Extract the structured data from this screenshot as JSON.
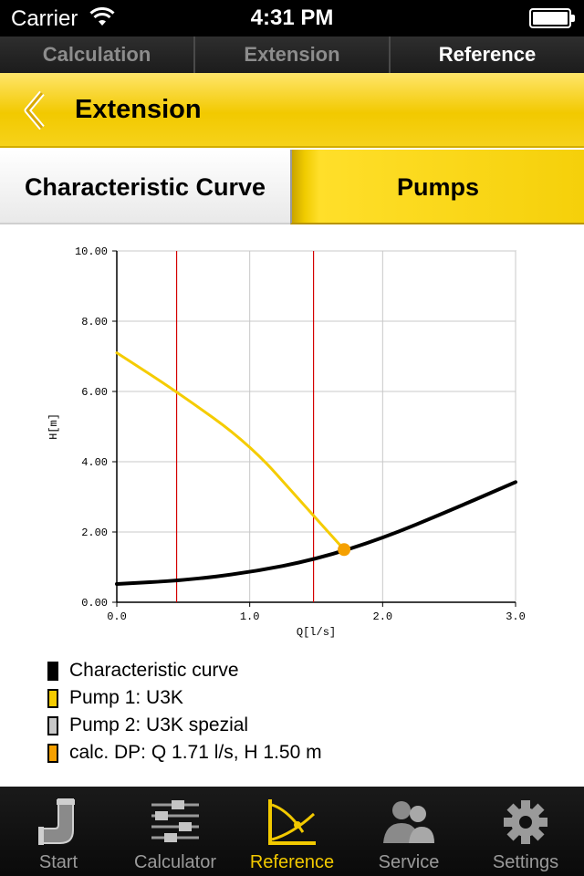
{
  "status_bar": {
    "carrier": "Carrier",
    "time": "4:31 PM"
  },
  "top_tabs": [
    {
      "label": "Calculation",
      "active": false
    },
    {
      "label": "Extension",
      "active": false
    },
    {
      "label": "Reference",
      "active": true
    }
  ],
  "header": {
    "title": "Extension",
    "back_icon": "chevron-left-icon"
  },
  "segments": {
    "left": "Characteristic Curve",
    "right": "Pumps",
    "selected": "Characteristic Curve"
  },
  "chart_data": {
    "type": "line",
    "xlabel": "Q[l/s]",
    "ylabel": "H[m]",
    "xlim": [
      0,
      3
    ],
    "ylim": [
      0,
      10
    ],
    "x_ticks": [
      "0.0",
      "1.0",
      "2.0",
      "3.0"
    ],
    "y_ticks": [
      "0.00",
      "2.00",
      "4.00",
      "6.00",
      "8.00",
      "10.00"
    ],
    "grid": true,
    "vertical_markers": [
      0.45,
      1.48
    ],
    "series": [
      {
        "name": "Characteristic curve",
        "color": "#000000",
        "x": [
          0.0,
          0.5,
          1.0,
          1.5,
          2.0,
          2.5,
          3.0
        ],
        "y": [
          0.52,
          0.62,
          0.85,
          1.22,
          1.82,
          2.6,
          3.42
        ]
      },
      {
        "name": "Pump 1: U3K",
        "color": "#f5cc00",
        "x": [
          0.0,
          0.45,
          1.0,
          1.4,
          1.71
        ],
        "y": [
          7.1,
          6.0,
          4.5,
          2.8,
          1.5
        ]
      }
    ],
    "operating_point": {
      "x": 1.71,
      "y": 1.5,
      "color": "#f5a000"
    }
  },
  "legend": [
    {
      "label": "Characteristic curve",
      "color": "#000000"
    },
    {
      "label": "Pump 1: U3K",
      "color": "#f5cc00"
    },
    {
      "label": "Pump 2: U3K spezial",
      "color": "#c8c8c8"
    },
    {
      "label": "calc. DP: Q 1.71 l/s, H 1.50 m",
      "color": "#f5a000"
    }
  ],
  "tab_bar": [
    {
      "label": "Start",
      "icon": "pipe-icon",
      "active": false
    },
    {
      "label": "Calculator",
      "icon": "sliders-icon",
      "active": false
    },
    {
      "label": "Reference",
      "icon": "curve-icon",
      "active": true
    },
    {
      "label": "Service",
      "icon": "people-icon",
      "active": false
    },
    {
      "label": "Settings",
      "icon": "gear-icon",
      "active": false
    }
  ]
}
